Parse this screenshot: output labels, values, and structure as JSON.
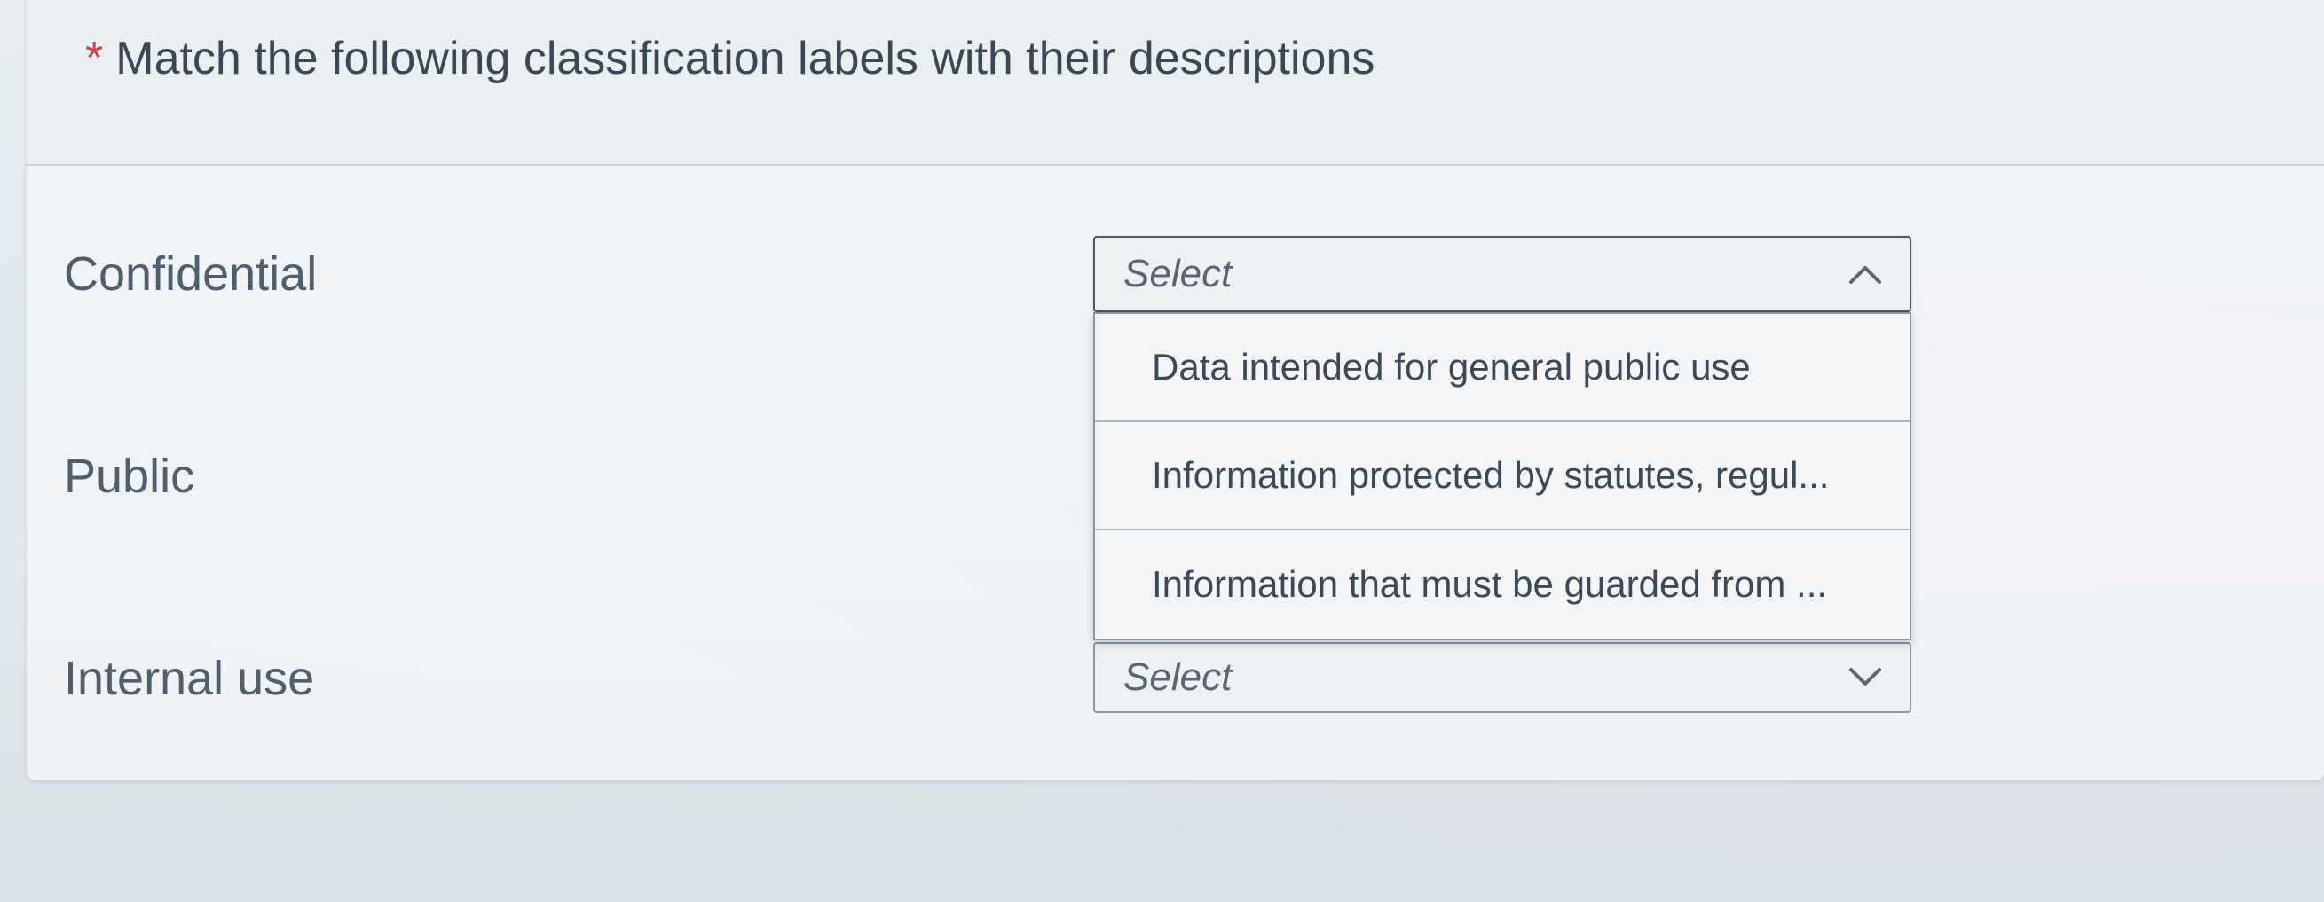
{
  "question": {
    "required_marker": "*",
    "title": "Match the following classification labels with their descriptions"
  },
  "rows": [
    {
      "label": "Confidential",
      "select_value": "Select",
      "state": "open"
    },
    {
      "label": "Public",
      "select_value": "Select",
      "state": "collapsed"
    },
    {
      "label": "Internal use",
      "select_value": "Select",
      "state": "collapsed"
    }
  ],
  "dropdown": {
    "options": [
      "Data intended for general public use",
      "Information protected by statutes, regul...",
      "Information that must be guarded from ..."
    ]
  },
  "icons": {
    "open_select": "chevron-up-icon",
    "closed_select": "chevron-down-icon"
  },
  "colors": {
    "required_marker": "#d0454c",
    "text": "#3a4855"
  }
}
